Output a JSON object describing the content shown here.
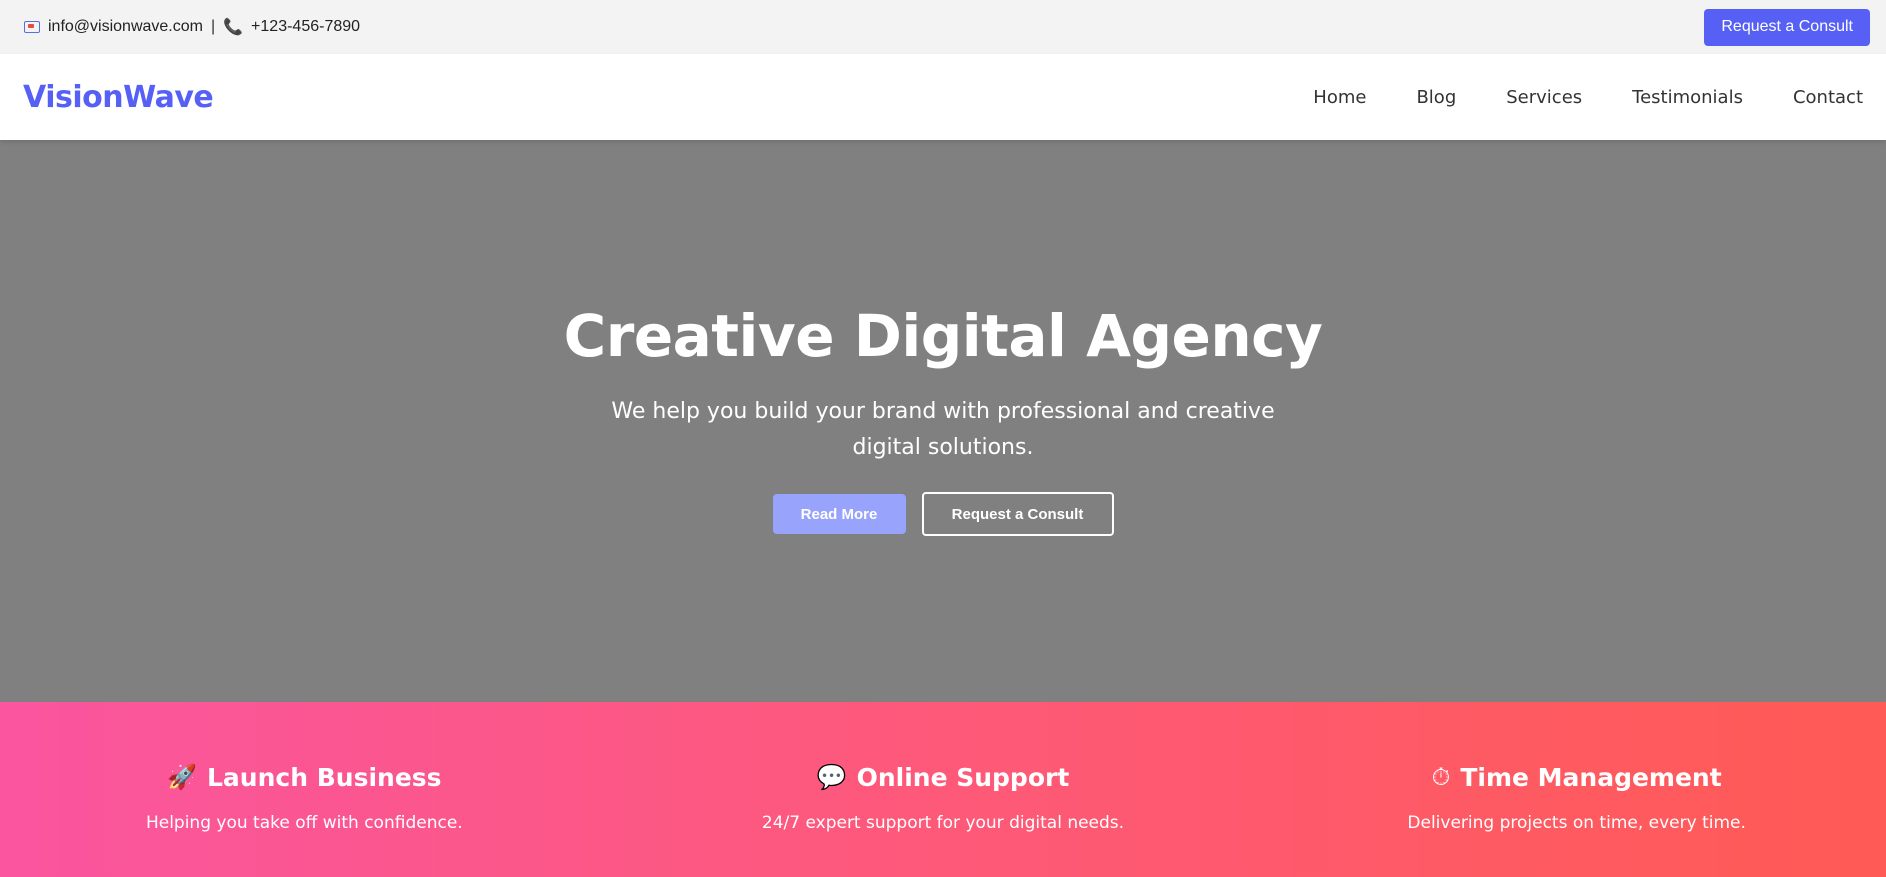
{
  "topbar": {
    "email": "info@visionwave.com",
    "separator": "|",
    "phone": "+123-456-7890",
    "cta_label": "Request a Consult"
  },
  "header": {
    "logo": "VisionWave",
    "nav": [
      {
        "label": "Home"
      },
      {
        "label": "Blog"
      },
      {
        "label": "Services"
      },
      {
        "label": "Testimonials"
      },
      {
        "label": "Contact"
      }
    ]
  },
  "hero": {
    "title": "Creative Digital Agency",
    "subtitle": "We help you build your brand with professional and creative digital solutions.",
    "primary_label": "Read More",
    "secondary_label": "Request a Consult"
  },
  "features": [
    {
      "icon": "🚀",
      "icon_name": "rocket-icon",
      "title": "Launch Business",
      "desc": "Helping you take off with confidence."
    },
    {
      "icon": "💬",
      "icon_name": "chat-bubble-icon",
      "title": "Online Support",
      "desc": "24/7 expert support for your digital needs."
    },
    {
      "icon": "⏱",
      "icon_name": "stopwatch-icon",
      "title": "Time Management",
      "desc": "Delivering projects on time, every time."
    }
  ],
  "colors": {
    "brand": "#5660f5",
    "hero_bg": "#808080",
    "read_more": "#98a4fb",
    "features_gradient_start": "#fa559f",
    "features_gradient_end": "#ff5a55"
  }
}
